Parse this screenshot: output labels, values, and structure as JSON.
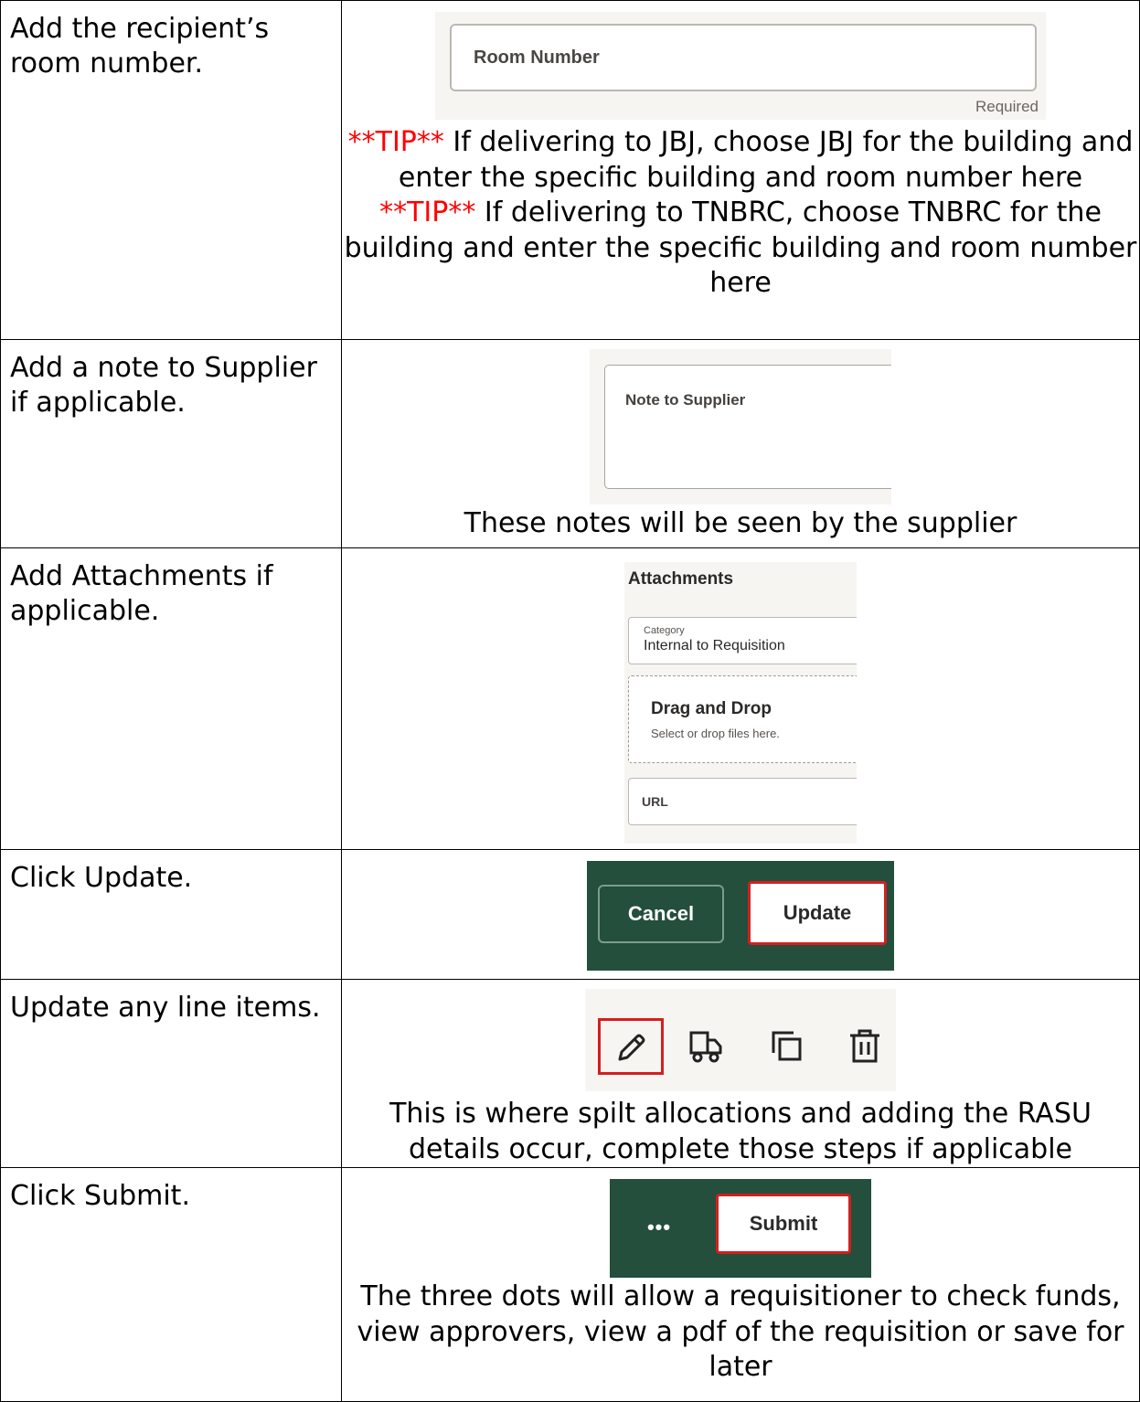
{
  "rows": [
    {
      "instruction": "Add the recipient’s room number.",
      "screenshot": {
        "field_label": "Room Number",
        "required_text": "Required"
      },
      "tips": [
        {
          "label": "**TIP**",
          "text": " If delivering to JBJ, choose JBJ for the building and enter the specific building and room number here"
        },
        {
          "label": "**TIP**",
          "text": " If delivering to TNBRC, choose TNBRC for the building and enter the specific building and room number here"
        }
      ]
    },
    {
      "instruction": "Add a note to Supplier if applicable.",
      "screenshot": {
        "field_label": "Note to Supplier"
      },
      "caption": "These notes will be seen by the supplier"
    },
    {
      "instruction": "Add Attachments if applicable.",
      "screenshot": {
        "heading": "Attachments",
        "category_label": "Category",
        "category_value": "Internal to Requisition",
        "drop_title": "Drag and Drop",
        "drop_subtitle": "Select or drop files here.",
        "url_label": "URL"
      }
    },
    {
      "instruction": "Click Update.",
      "screenshot": {
        "cancel_label": "Cancel",
        "update_label": "Update"
      }
    },
    {
      "instruction": "Update any line items.",
      "screenshot": {
        "icons": [
          "pencil-icon",
          "truck-icon",
          "duplicate-icon",
          "trash-icon"
        ]
      },
      "caption": "This is where spilt allocations and adding the RASU details occur, complete those steps if applicable"
    },
    {
      "instruction": "Click Submit.",
      "screenshot": {
        "more_label": "•••",
        "submit_label": "Submit"
      },
      "caption": "The three dots will allow a requisitioner to check funds, view approvers, view a pdf of the requisition or save for later"
    }
  ],
  "colors": {
    "tip_red": "#ff0000",
    "bar_green": "#234f3c",
    "highlight_red": "#d31f1f",
    "snapshot_bg": "#f7f5f2"
  }
}
